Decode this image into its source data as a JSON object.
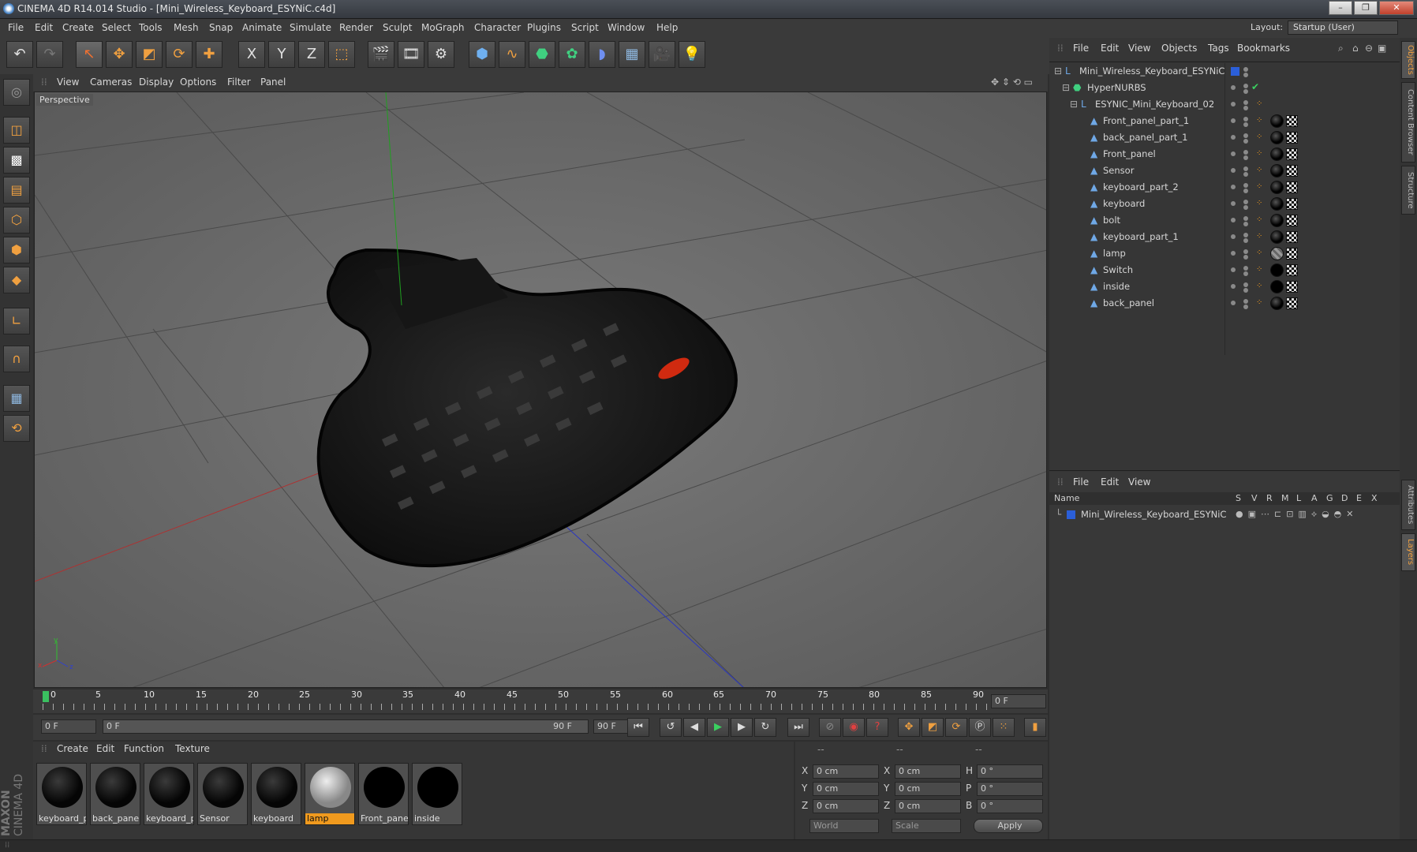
{
  "window": {
    "title": "CINEMA 4D R14.014 Studio - [Mini_Wireless_Keyboard_ESYNiC.c4d]",
    "controls": [
      "–",
      "❐",
      "✕"
    ]
  },
  "menubar": {
    "items": [
      "File",
      "Edit",
      "Create",
      "Select",
      "Tools",
      "Mesh",
      "Snap",
      "Animate",
      "Simulate",
      "Render",
      "Sculpt",
      "MoGraph",
      "Character",
      "Plugins",
      "Script",
      "Window",
      "Help"
    ],
    "layout_label": "Layout:",
    "layout_value": "Startup (User)"
  },
  "toolbar": {
    "icons": [
      "undo-icon",
      "redo-icon",
      "live-select-icon",
      "move-icon",
      "scale-icon",
      "rotate-icon",
      "add-icon",
      "x-axis-icon",
      "y-axis-icon",
      "z-axis-icon",
      "world-coord-icon",
      "render-view-icon",
      "render-picture-icon",
      "render-settings-icon",
      "cube-icon",
      "spline-icon",
      "nurbs-icon",
      "array-icon",
      "deformer-icon",
      "floor-icon",
      "camera-icon",
      "light-icon"
    ],
    "axis_labels": [
      "X",
      "Y",
      "Z"
    ]
  },
  "viewport": {
    "menu": [
      "View",
      "Cameras",
      "Display",
      "Options",
      "Filter",
      "Panel"
    ],
    "label": "Perspective",
    "axis_x": "x",
    "axis_y": "y",
    "axis_z": "z"
  },
  "timeline": {
    "ticks": [
      "0",
      "5",
      "10",
      "15",
      "20",
      "25",
      "30",
      "35",
      "40",
      "45",
      "50",
      "55",
      "60",
      "65",
      "70",
      "75",
      "80",
      "85",
      "90"
    ],
    "current_frame": "0 F",
    "start_field": "0 F",
    "range_start": "0 F",
    "range_end": "90 F",
    "end_field": "90 F"
  },
  "materials": {
    "menu": [
      "Create",
      "Edit",
      "Function",
      "Texture"
    ],
    "items": [
      {
        "label": "keyboard_p",
        "selected": false
      },
      {
        "label": "back_pane",
        "selected": false
      },
      {
        "label": "keyboard_p",
        "selected": false
      },
      {
        "label": "Sensor",
        "selected": false
      },
      {
        "label": "keyboard",
        "selected": false
      },
      {
        "label": "lamp",
        "selected": true
      },
      {
        "label": "Front_pane",
        "selected": false
      },
      {
        "label": "inside",
        "selected": false
      }
    ]
  },
  "coords": {
    "headers": [
      "--",
      "--",
      "--"
    ],
    "rows": [
      {
        "a": "X",
        "av": "0 cm",
        "b": "X",
        "bv": "0 cm",
        "c": "H",
        "cv": "0 °"
      },
      {
        "a": "Y",
        "av": "0 cm",
        "b": "Y",
        "bv": "0 cm",
        "c": "P",
        "cv": "0 °"
      },
      {
        "a": "Z",
        "av": "0 cm",
        "b": "Z",
        "bv": "0 cm",
        "c": "B",
        "cv": "0 °"
      }
    ],
    "world": "World",
    "scale": "Scale",
    "apply": "Apply"
  },
  "brand": {
    "line1": "MAXON",
    "line2": "CINEMA 4D"
  },
  "objects": {
    "menu": [
      "File",
      "Edit",
      "View",
      "Objects",
      "Tags",
      "Bookmarks"
    ],
    "root": "Mini_Wireless_Keyboard_ESYNiC",
    "hypernurbs": "HyperNURBS",
    "group": "ESYNIC_Mini_Keyboard_02",
    "children": [
      "Front_panel_part_1",
      "back_panel_part_1",
      "Front_panel",
      "Sensor",
      "keyboard_part_2",
      "keyboard",
      "bolt",
      "keyboard_part_1",
      "lamp",
      "Switch",
      "inside",
      "back_panel"
    ]
  },
  "layers": {
    "menu": [
      "File",
      "Edit",
      "View"
    ],
    "columns": [
      "Name",
      "S",
      "V",
      "R",
      "M",
      "L",
      "A",
      "G",
      "D",
      "E",
      "X"
    ],
    "row": "Mini_Wireless_Keyboard_ESYNiC"
  },
  "side_tabs": [
    "Objects",
    "Content Browser",
    "Structure",
    "Attributes",
    "Layers"
  ],
  "colors": {
    "accent": "#f09a1e",
    "layer_blue": "#2b5fd9",
    "viewport_bg": "#6a6a6a"
  }
}
